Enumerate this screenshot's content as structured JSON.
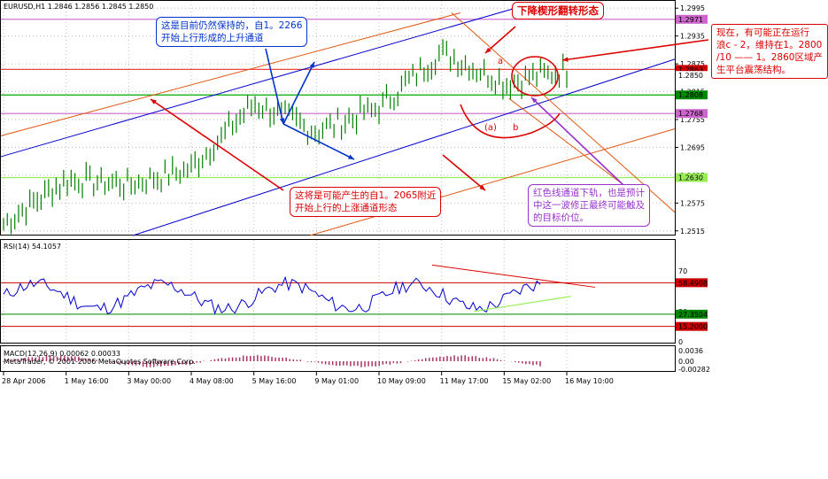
{
  "colors": {
    "candle": "#008000",
    "channel_blue": "#0000cc",
    "channel_orange": "#e0560f",
    "level_magenta": "#cc66cc",
    "level_green": "#00aa00",
    "level_lime": "#99ee55",
    "note_red": "#dd0000",
    "note_purple": "#9933cc",
    "note_blue": "#0033cc",
    "rsi_line": "#0000cc",
    "macd_hist": "#aa3366"
  },
  "main_chart": {
    "header": "EURUSD,H1  1.2846 1.2856 1.2845 1.2850",
    "price_ticks": [
      "1.2995",
      "1.2935",
      "1.2875",
      "1.2815",
      "1.2755",
      "1.2695",
      "1.2635",
      "1.2575",
      "1.2515"
    ],
    "price_labels": [
      {
        "text": "1.2971",
        "bg": "#cc66cc",
        "fg": "#ffffff"
      },
      {
        "text": "1.2863",
        "bg": "#cc0000",
        "fg": "#ffffff"
      },
      {
        "text": "1.2850",
        "bg": "#ffffff",
        "fg": "#000000"
      },
      {
        "text": "1.2808",
        "bg": "#008800",
        "fg": "#ffffff"
      },
      {
        "text": "1.2768",
        "bg": "#cc66cc",
        "fg": "#ffffff"
      },
      {
        "text": "1.2630",
        "bg": "#99ee55",
        "fg": "#000000"
      }
    ],
    "chart_labels": {
      "a": "a",
      "b": "b",
      "ab": "(a)"
    }
  },
  "notes": {
    "blue_note": [
      "这是目前仍然保持的，自1。2266",
      "开始上行形成的上升通道"
    ],
    "title_note": "下降楔形翻转形态",
    "right_note": [
      "现在，有可能正在运行",
      "浪c - 2，维持在1。2800",
      "/10 —— 1。2860区域产",
      "生平台震荡结构。"
    ],
    "red_note": [
      "这将是可能产生的自1。2065附近",
      "开始上行的上涨通道形态"
    ],
    "purple_note": [
      "红色线通道下轨，也是预计",
      "中这一波修正最终可能触及",
      "的目标价位。"
    ]
  },
  "rsi_panel": {
    "header": "RSI(14) 54.1057",
    "ticks": [
      "70",
      "30",
      "0"
    ],
    "labels": [
      {
        "text": "58.4908",
        "bg": "#cc0000",
        "fg": "#ffffff"
      },
      {
        "text": "27.3504",
        "bg": "#008800",
        "fg": "#ffffff"
      },
      {
        "text": "15.2000",
        "bg": "#cc0000",
        "fg": "#ffffff"
      }
    ]
  },
  "macd_panel": {
    "header": "MACD(12,26,9) 0.00062 0.00033",
    "copyright": "MetaTrader, © 2001-2006 MetaQuotes Software Corp.",
    "ticks": [
      "0.0036",
      "0.00",
      "-0.00282"
    ]
  },
  "time_axis": [
    "28 Apr 2006",
    "1 May 16:00",
    "3 May 00:00",
    "4 May 08:00",
    "5 May 16:00",
    "9 May 01:00",
    "10 May 09:00",
    "11 May 17:00",
    "15 May 02:00",
    "16 May 10:00"
  ],
  "chart_data": {
    "type": "line",
    "title": "EURUSD,H1  1.2846 1.2856 1.2845 1.2850",
    "x": [
      "28 Apr 2006",
      "1 May 16:00",
      "3 May 00:00",
      "4 May 08:00",
      "5 May 16:00",
      "9 May 01:00",
      "10 May 09:00",
      "11 May 17:00",
      "15 May 02:00",
      "16 May 10:00"
    ],
    "series": [
      {
        "values": [
          1.253,
          1.2625,
          1.2615,
          1.265,
          1.279,
          1.273,
          1.278,
          1.29,
          1.2835,
          1.286
        ]
      }
    ],
    "ylim": [
      1.2505,
      1.3005
    ],
    "xlabel": "",
    "ylabel": ""
  }
}
